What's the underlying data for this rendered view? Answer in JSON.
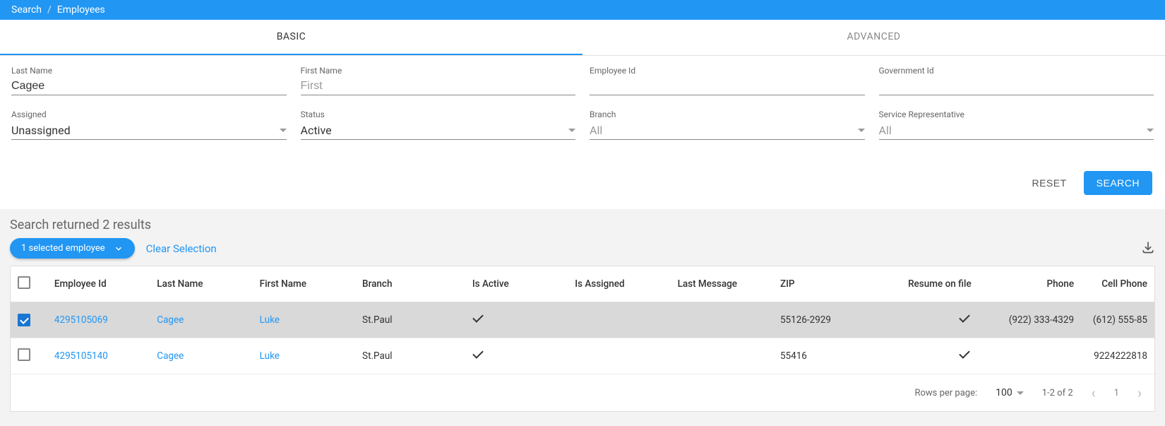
{
  "breadcrumb": {
    "root": "Search",
    "current": "Employees"
  },
  "tabs": {
    "basic": "BASIC",
    "advanced": "ADVANCED"
  },
  "fields": {
    "last_name": {
      "label": "Last Name",
      "value": "Cagee",
      "placeholder": ""
    },
    "first_name": {
      "label": "First Name",
      "value": "",
      "placeholder": "First"
    },
    "employee_id": {
      "label": "Employee Id",
      "value": "",
      "placeholder": ""
    },
    "gov_id": {
      "label": "Government Id",
      "value": "",
      "placeholder": ""
    },
    "assigned": {
      "label": "Assigned",
      "value": "Unassigned"
    },
    "status": {
      "label": "Status",
      "value": "Active"
    },
    "branch": {
      "label": "Branch",
      "value": "All",
      "placeholder": true
    },
    "service_rep": {
      "label": "Service Representative",
      "value": "All",
      "placeholder": true
    }
  },
  "buttons": {
    "reset": "RESET",
    "search": "SEARCH"
  },
  "results": {
    "heading": "Search returned 2 results",
    "selected_pill": "1 selected employee",
    "clear": "Clear Selection"
  },
  "columns": {
    "employee_id": "Employee Id",
    "last_name": "Last Name",
    "first_name": "First Name",
    "branch": "Branch",
    "is_active": "Is Active",
    "is_assigned": "Is Assigned",
    "last_message": "Last Message",
    "zip": "ZIP",
    "resume": "Resume on file",
    "phone": "Phone",
    "cell": "Cell Phone"
  },
  "rows": [
    {
      "selected": true,
      "employee_id": "4295105069",
      "last_name": "Cagee",
      "first_name": "Luke",
      "branch": "St.Paul",
      "is_active": true,
      "is_assigned": "",
      "last_message": "",
      "zip": "55126-2929",
      "resume": true,
      "phone": "(922) 333-4329",
      "cell": "(612) 555-85"
    },
    {
      "selected": false,
      "employee_id": "4295105140",
      "last_name": "Cagee",
      "first_name": "Luke",
      "branch": "St.Paul",
      "is_active": true,
      "is_assigned": "",
      "last_message": "",
      "zip": "55416",
      "resume": true,
      "phone": "",
      "cell": "9224222818"
    }
  ],
  "pagination": {
    "rpp_label": "Rows per page:",
    "rpp_value": "100",
    "range": "1-2 of 2",
    "page": "1"
  }
}
